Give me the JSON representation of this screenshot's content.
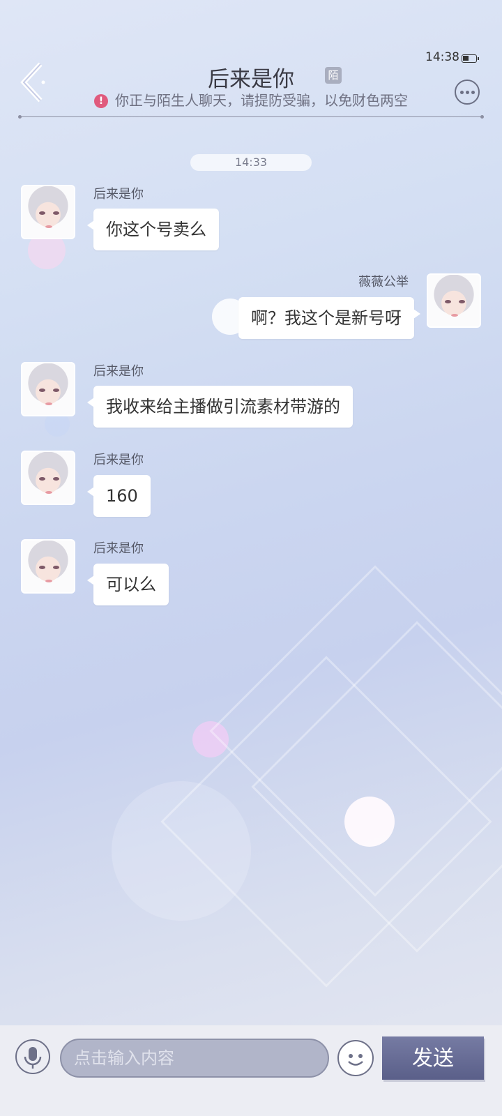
{
  "status_bar": {
    "time": "14:38",
    "battery_level": 0.45
  },
  "header": {
    "title": "后来是你",
    "stranger_tag": "陌",
    "warning": "你正与陌生人聊天，请提防受骗，以免财色两空",
    "icons": {
      "back": "back-arrow-icon",
      "more": "more-dots-icon",
      "warning": "exclamation-icon"
    }
  },
  "chat": {
    "timestamp": "14:33",
    "messages": [
      {
        "side": "left",
        "sender": "后来是你",
        "text": "你这个号卖么"
      },
      {
        "side": "right",
        "sender": "薇薇公举",
        "text": "啊？我这个是新号呀"
      },
      {
        "side": "left",
        "sender": "后来是你",
        "text": "我收来给主播做引流素材带游的"
      },
      {
        "side": "left",
        "sender": "后来是你",
        "text": "160"
      },
      {
        "side": "left",
        "sender": "后来是你",
        "text": "可以么"
      }
    ]
  },
  "input_bar": {
    "placeholder": "点击输入内容",
    "send_label": "发送",
    "icons": {
      "mic": "microphone-icon",
      "emoji": "emoji-face-icon"
    }
  },
  "colors": {
    "accent": "#5a5f89",
    "warning": "#e05a7d",
    "bubble": "#ffffff"
  }
}
